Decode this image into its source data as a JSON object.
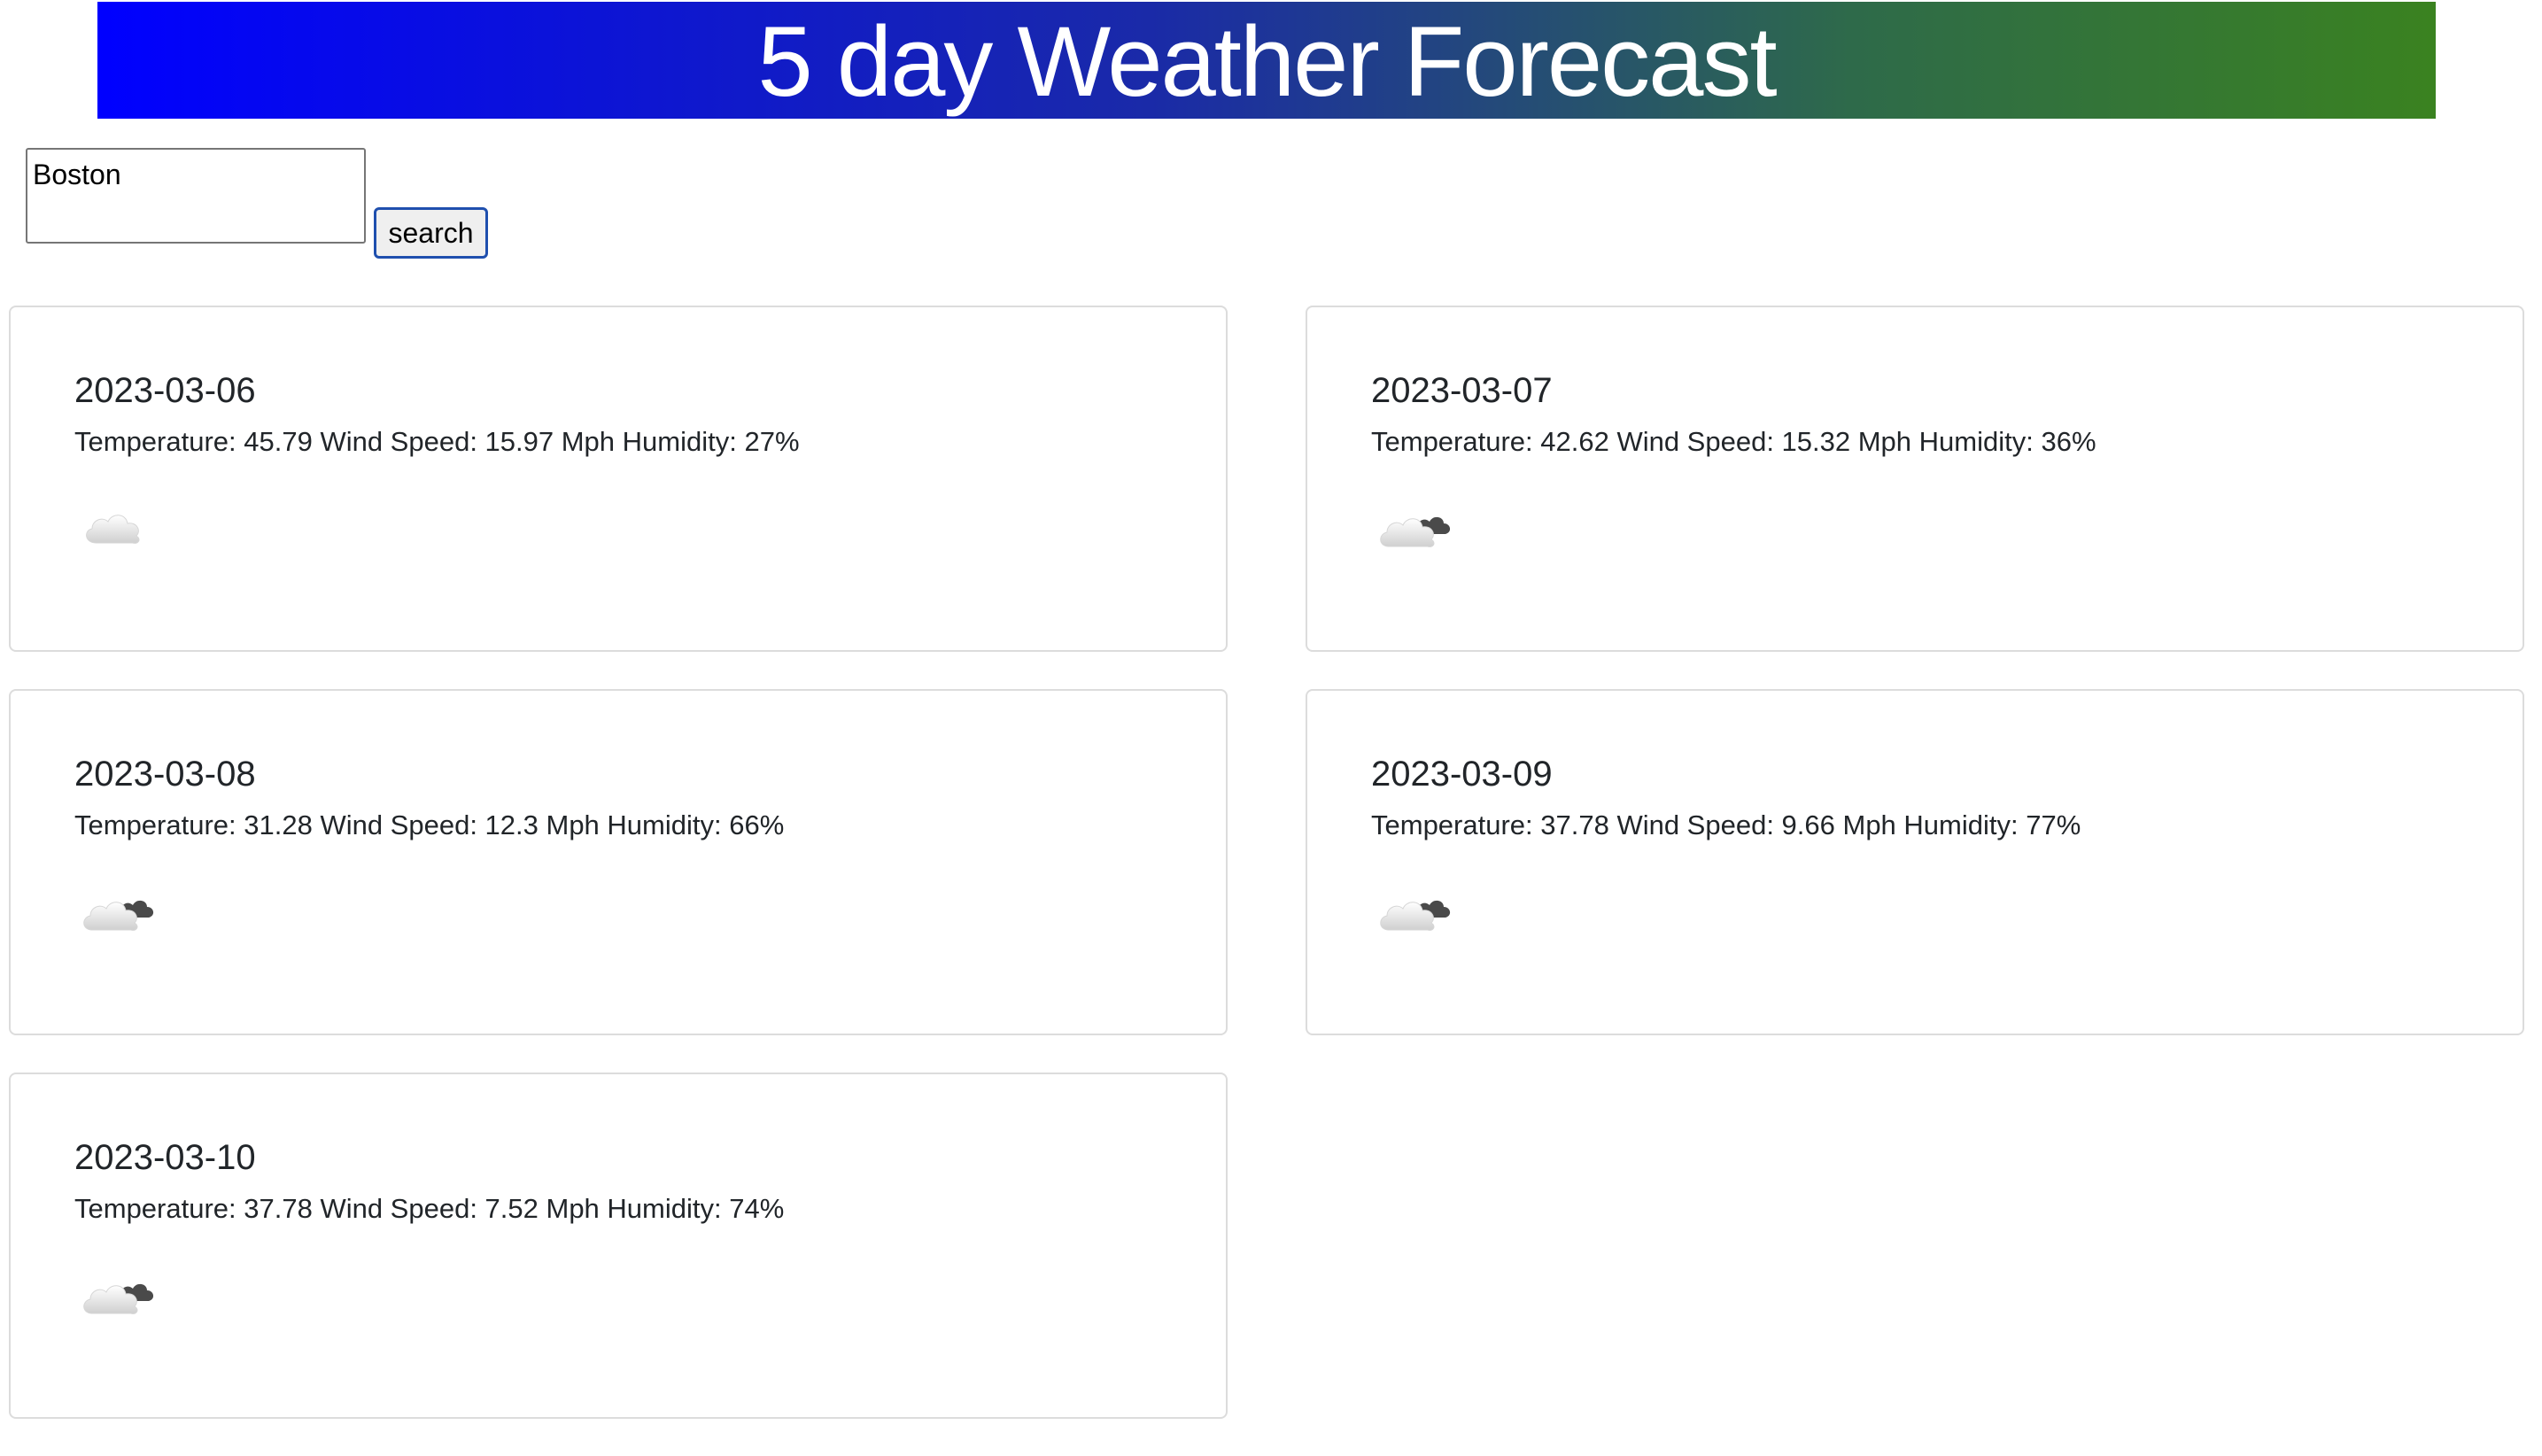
{
  "header": {
    "title": "5 day Weather Forecast"
  },
  "search": {
    "value": "Boston",
    "button_label": "search"
  },
  "forecast": [
    {
      "date": "2023-03-06",
      "details": "Temperature: 45.79 Wind Speed: 15.97 Mph Humidity: 27%",
      "icon": "cloud-icon"
    },
    {
      "date": "2023-03-07",
      "details": "Temperature: 42.62 Wind Speed: 15.32 Mph Humidity: 36%",
      "icon": "broken-clouds-icon"
    },
    {
      "date": "2023-03-08",
      "details": "Temperature: 31.28 Wind Speed: 12.3 Mph Humidity: 66%",
      "icon": "broken-clouds-icon"
    },
    {
      "date": "2023-03-09",
      "details": "Temperature: 37.78 Wind Speed: 9.66 Mph Humidity: 77%",
      "icon": "broken-clouds-icon"
    },
    {
      "date": "2023-03-10",
      "details": "Temperature: 37.78 Wind Speed: 7.52 Mph Humidity: 74%",
      "icon": "broken-clouds-icon"
    }
  ]
}
